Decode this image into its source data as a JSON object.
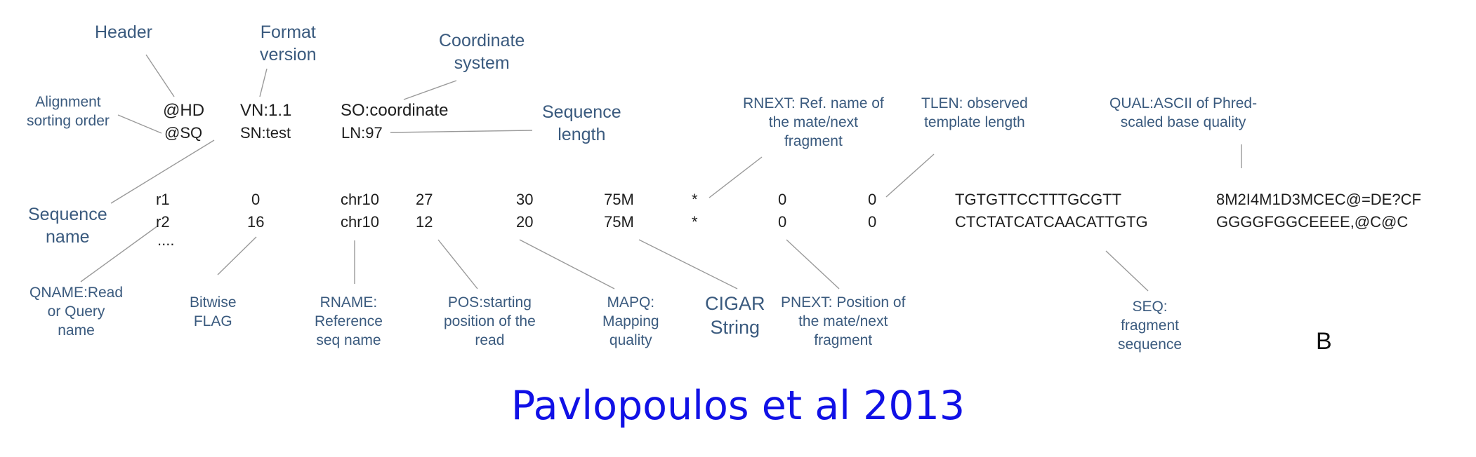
{
  "header_lines": [
    {
      "id": "hd",
      "fields": [
        "@HD",
        "VN:1.1",
        "SO:coordinate"
      ]
    },
    {
      "id": "sq",
      "fields": [
        "@SQ",
        "SN:test",
        "LN:97"
      ]
    }
  ],
  "alignment_rows": [
    {
      "id": "r1",
      "fields": [
        "r1",
        "0",
        "chr10",
        "27",
        "30",
        "75M",
        "*",
        "0",
        "0",
        "TGTGTTCCTTTGCGTT",
        "8M2I4M1D3MCEC@=DE?CF"
      ]
    },
    {
      "id": "r2",
      "fields": [
        "r2",
        "16",
        "chr10",
        "12",
        "20",
        "75M",
        "*",
        "0",
        "0",
        "CTCTATCATCAACATTGTG",
        "GGGGFGGCEEEE,@C@C"
      ]
    }
  ],
  "ellipsis": "....",
  "annotations": {
    "header": [
      "Header"
    ],
    "format_version": [
      "Format",
      "version"
    ],
    "coordinate_system": [
      "Coordinate",
      "system"
    ],
    "alignment_sorting_order": [
      "Alignment",
      "sorting order"
    ],
    "sequence_length": [
      "Sequence",
      "length"
    ],
    "rnext": [
      "RNEXT: Ref. name of",
      "the mate/next",
      "fragment"
    ],
    "tlen": [
      "TLEN: observed",
      "template length"
    ],
    "qual": [
      "QUAL:ASCII of Phred-",
      "scaled base quality"
    ],
    "sequence_name": [
      "Sequence",
      "name"
    ],
    "qname": [
      "QNAME:Read",
      "or Query",
      "name"
    ],
    "flag": [
      "Bitwise",
      "FLAG"
    ],
    "rname": [
      "RNAME:",
      "Reference",
      "seq name"
    ],
    "pos": [
      "POS:starting",
      "position of the",
      "read"
    ],
    "mapq": [
      "MAPQ:",
      "Mapping",
      "quality"
    ],
    "cigar": [
      "CIGAR",
      "String"
    ],
    "pnext": [
      "PNEXT: Position of",
      "the mate/next",
      "fragment"
    ],
    "seq": [
      "SEQ:",
      "fragment",
      "sequence"
    ]
  },
  "panel_letter": "B",
  "citation": "Pavlopoulos et al 2013"
}
